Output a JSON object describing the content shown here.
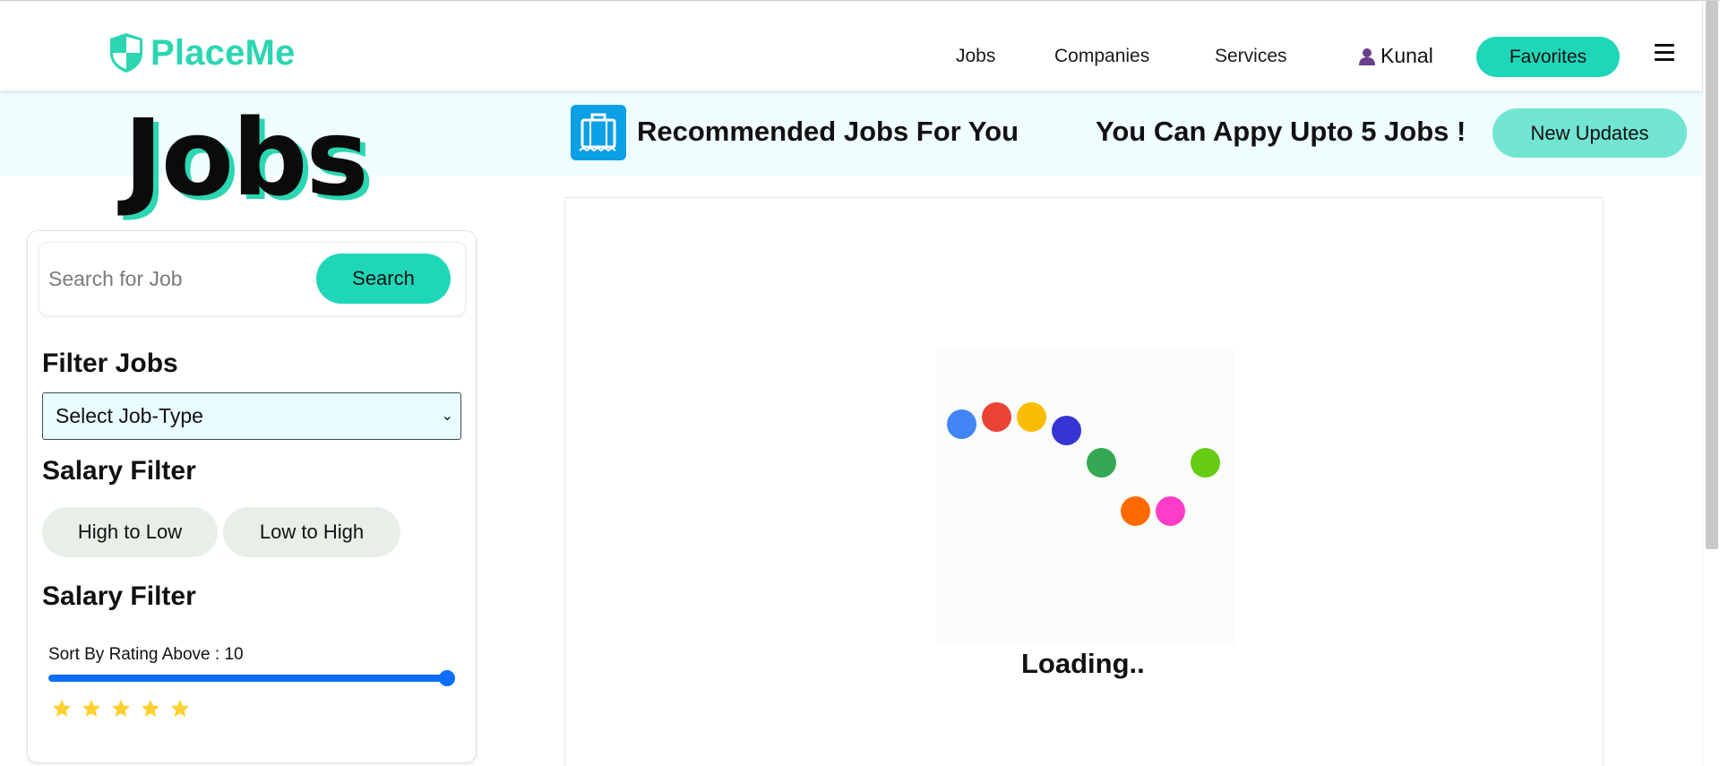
{
  "navbar": {
    "brand": "PlaceMe",
    "links": [
      "Jobs",
      "Companies",
      "Services"
    ],
    "user_name": "Kunal",
    "favorites_label": "Favorites"
  },
  "page": {
    "heading": "Jobs"
  },
  "banner": {
    "recommended_title": "Recommended Jobs For You",
    "limit_text": "You Can Appy Upto 5 Jobs !",
    "new_updates_label": "New Updates"
  },
  "sidebar": {
    "search_placeholder": "Search for Job",
    "search_label": "Search",
    "filter_jobs_title": "Filter Jobs",
    "job_type_selected": "Select Job-Type",
    "salary_filter_title": "Salary Filter",
    "sort_high_low": "High to Low",
    "sort_low_high": "Low to High",
    "rating_filter_title": "Salary Filter",
    "rating_label": "Sort By Rating Above : 10",
    "rating_value": 10,
    "stars_filled": 5
  },
  "content": {
    "loading_text": "Loading..",
    "loader_dot_colors": [
      "#4285f4",
      "#ea4335",
      "#fbbc05",
      "#3535d6",
      "#34a853",
      "#66cc12",
      "#ff6a00",
      "#ff3cc8"
    ]
  },
  "colors": {
    "brand_teal": "#2bd6b2",
    "button_teal": "#1fd7b8",
    "banner_bg": "#effdff",
    "slider_blue": "#0d6efd",
    "star_yellow": "#ffcf2e",
    "bag_blue": "#0aa0e6"
  }
}
